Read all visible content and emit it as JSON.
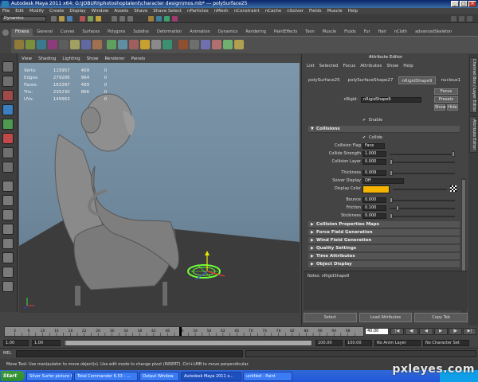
{
  "window": {
    "title": "Autodesk Maya 2011 x64: G:\\JOBURI\\photoshoptalent\\character design\\mos.mb*   ---   polySurface25",
    "buttons": [
      "_",
      "□",
      "×"
    ]
  },
  "menubar": [
    "File",
    "Edit",
    "Modify",
    "Create",
    "Display",
    "Window",
    "Assets",
    "Shave",
    "Shave Select",
    "nParticles",
    "nMesh",
    "nConstraint",
    "nCache",
    "nSolver",
    "Fields",
    "Muscle",
    "Help"
  ],
  "status_line": {
    "mode": "Dynamics"
  },
  "shelf_tabs": {
    "items": [
      "Fitness",
      "General",
      "Curves",
      "Surfaces",
      "Polygons",
      "Subdivs",
      "Deformation",
      "Animation",
      "Dynamics",
      "Rendering",
      "PaintEffects",
      "Toon",
      "Muscle",
      "Fluids",
      "Fur",
      "Hair",
      "nCloth",
      "advancedSkeleton"
    ],
    "active": "Fitness"
  },
  "viewport": {
    "menu": [
      "View",
      "Shading",
      "Lighting",
      "Show",
      "Renderer",
      "Panels"
    ],
    "hud": [
      {
        "label": "Verts:",
        "v1": "115957",
        "v2": "409",
        "v3": "0"
      },
      {
        "label": "Edges:",
        "v1": "279286",
        "v2": "964",
        "v3": "0"
      },
      {
        "label": "Faces:",
        "v1": "163397",
        "v2": "489",
        "v3": "0"
      },
      {
        "label": "Tris:",
        "v1": "235230",
        "v2": "866",
        "v3": "0"
      },
      {
        "label": "UVs:",
        "v1": "149963",
        "v2": "",
        "v3": "0"
      }
    ]
  },
  "attribute_editor": {
    "title": "Attribute Editor",
    "menu": [
      "List",
      "Selected",
      "Focus",
      "Attributes",
      "Show",
      "Help"
    ],
    "tabs": [
      "polySurface25",
      "polySurfaceShape27",
      "nRigidShape9",
      "nucleus1"
    ],
    "active_tab": "nRigidShape9",
    "node_label": "nRigid:",
    "node_name": "nRigidShape9",
    "focus_btn": "Focus",
    "presets_btn": "Presets",
    "show_btn": "Show",
    "hide_btn": "Hide",
    "enable_label": "Enable",
    "collisions_section": "Collisions",
    "collide_label": "Collide",
    "collision_flag_label": "Collision Flag",
    "collision_flag_value": "Face",
    "collide_strength_label": "Collide Strength",
    "collide_strength_value": "1.000",
    "collision_layer_label": "Collision Layer",
    "collision_layer_value": "0.000",
    "thickness_label": "Thickness",
    "thickness_value": "0.009",
    "solver_display_label": "Solver Display",
    "solver_display_value": "Off",
    "display_color_label": "Display Color",
    "display_color_hex": "#f5b400",
    "bounce_label": "Bounce",
    "bounce_value": "0.000",
    "friction_label": "Friction",
    "friction_value": "0.100",
    "stickiness_label": "Stickiness",
    "stickiness_value": "0.000",
    "sections": [
      "Collision Properties Maps",
      "Force Field Generation",
      "Wind Field Generation",
      "Quality Settings",
      "Time Attributes",
      "Object Display"
    ],
    "notes": "Notes: nRigidShape9",
    "bottom_buttons": [
      "Select",
      "Load Attributes",
      "Copy Tab"
    ]
  },
  "right_vtabs": [
    "Channel Box / Layer Editor",
    "Attribute Editor"
  ],
  "timeline": {
    "ticks": [
      "2",
      "4",
      "6",
      "8",
      "10",
      "12",
      "14",
      "16",
      "18",
      "20",
      "22",
      "24",
      "26",
      "28",
      "30",
      "32",
      "34",
      "36",
      "38",
      "40",
      "42",
      "44",
      "46",
      "48",
      "50",
      "52",
      "54",
      "56",
      "58",
      "60",
      "62",
      "64",
      "66",
      "68",
      "70",
      "72",
      "74",
      "76",
      "78",
      "80",
      "82",
      "84",
      "86",
      "88",
      "90",
      "92",
      "94",
      "96",
      "98",
      "100"
    ],
    "current_frame": "40.00",
    "playback_buttons": [
      "|◀",
      "◀|",
      "◀",
      "▶",
      "|▶",
      "▶|"
    ]
  },
  "range": {
    "start": "1.00",
    "anim_start": "1.00",
    "anim_end": "100.00",
    "end": "100.00",
    "anim_layer": "No Anim Layer",
    "character": "No Character Set"
  },
  "command_line": {
    "label": "MEL"
  },
  "help_line": "Move Tool: Use manipulator to move object(s). Use edit mode to change pivot (INSERT). Ctrl+LMB to move perpendicular.",
  "taskbar": {
    "start": "Start",
    "tasks": [
      "Silver Surfer picture for...",
      "Total Commander 6.53 - ...",
      "Output Window",
      "Autodesk Maya 2011 x...",
      "untitled - Paint"
    ],
    "active_task": "Autodesk Maya 2011 x..."
  },
  "watermark": "pxleyes.com"
}
